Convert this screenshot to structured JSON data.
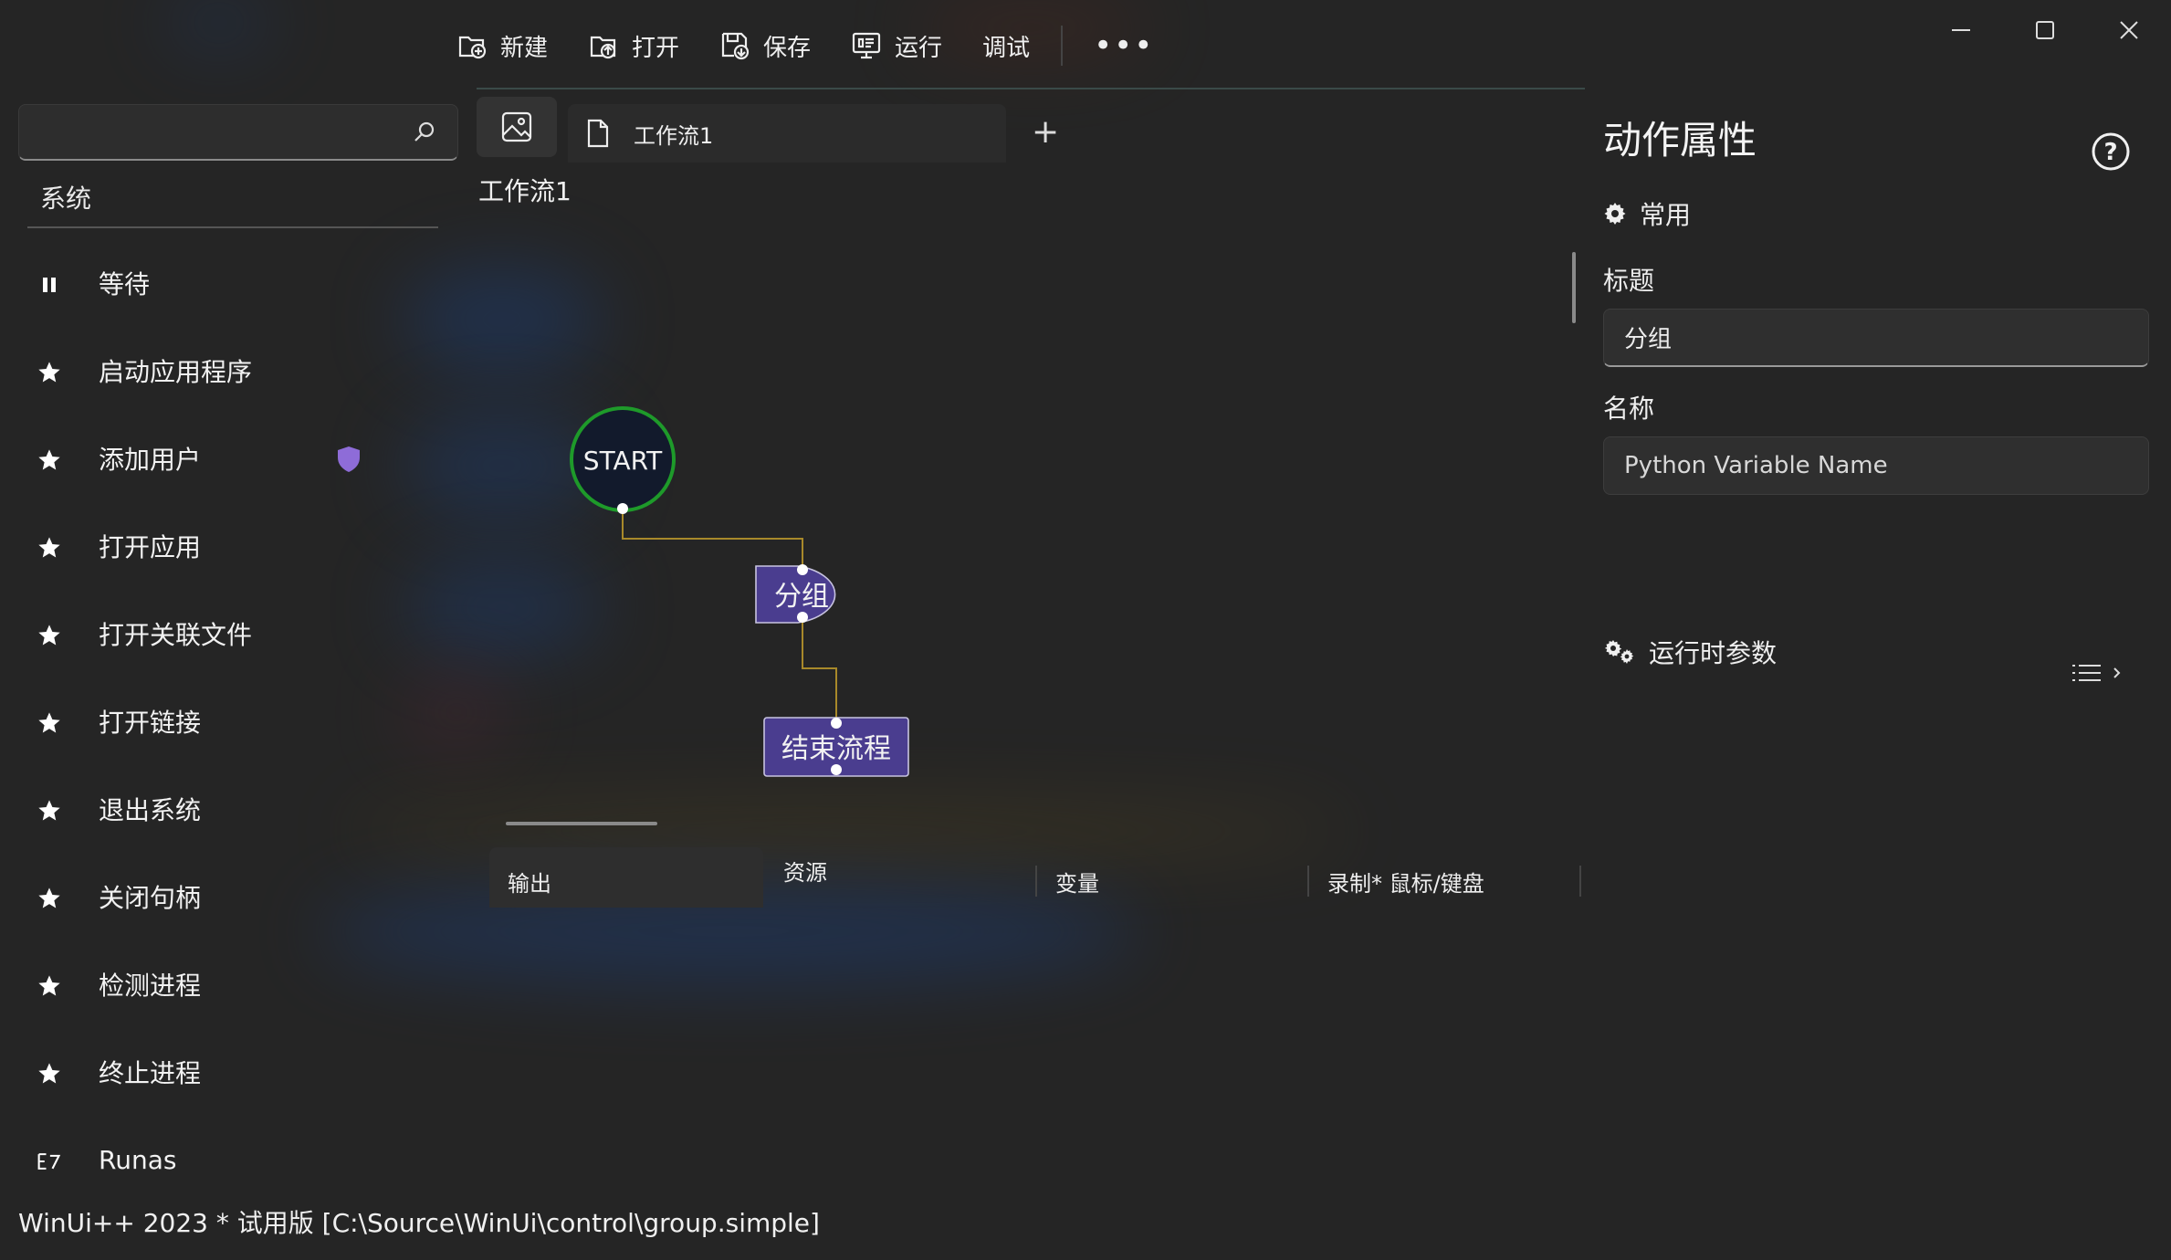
{
  "toolbar": {
    "new_label": "新建",
    "open_label": "打开",
    "save_label": "保存",
    "run_label": "运行",
    "debug_label": "调试",
    "more_label": "•••"
  },
  "sidebar": {
    "search_placeholder": "",
    "section_title": "系统",
    "items": [
      {
        "label": "等待",
        "icon": "pause-icon"
      },
      {
        "label": "启动应用程序",
        "icon": "star-icon"
      },
      {
        "label": "添加用户",
        "icon": "star-icon",
        "badge": "shield-icon"
      },
      {
        "label": "打开应用",
        "icon": "star-icon"
      },
      {
        "label": "打开关联文件",
        "icon": "star-icon"
      },
      {
        "label": "打开链接",
        "icon": "star-icon"
      },
      {
        "label": "退出系统",
        "icon": "star-icon"
      },
      {
        "label": "关闭句柄",
        "icon": "star-icon"
      },
      {
        "label": "检测进程",
        "icon": "star-icon"
      },
      {
        "label": "终止进程",
        "icon": "star-icon"
      },
      {
        "label": "Runas",
        "icon": "runas-icon"
      }
    ]
  },
  "document": {
    "tab_label": "工作流1",
    "canvas_title": "工作流1",
    "add_tab": "+"
  },
  "flow": {
    "start_label": "START",
    "group_label": "分组",
    "end_label": "结束流程"
  },
  "bottom_tabs": {
    "output": "输出",
    "resources": "资源",
    "variables": "变量",
    "record": "录制* 鼠标/键盘"
  },
  "properties": {
    "title": "动作属性",
    "common_label": "常用",
    "title_field_label": "标题",
    "title_field_value": "分组",
    "name_field_label": "名称",
    "name_field_placeholder": "Python Variable Name",
    "runtime_label": "运行时参数"
  },
  "status": {
    "text": "WinUi++ 2023 * 试用版 [C:\\Source\\WinUi\\control\\group.simple]"
  },
  "colors": {
    "node_fill": "#4a3d8f",
    "start_ring": "#1e9a2a",
    "connector": "#a8892a",
    "shield": "#8e6cd8"
  }
}
